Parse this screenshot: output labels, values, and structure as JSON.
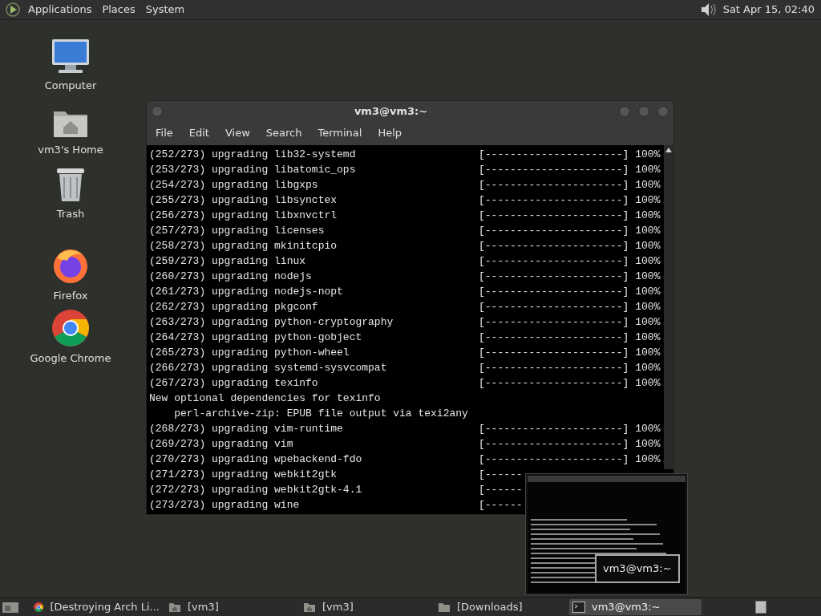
{
  "top_panel": {
    "menus": [
      "Applications",
      "Places",
      "System"
    ],
    "clock": "Sat Apr 15, 02:40"
  },
  "desktop_icons": [
    {
      "kind": "computer",
      "label": "Computer"
    },
    {
      "kind": "home",
      "label": "vm3's Home"
    },
    {
      "kind": "trash",
      "label": "Trash"
    },
    {
      "kind": "firefox",
      "label": "Firefox"
    },
    {
      "kind": "chrome",
      "label": "Google Chrome"
    }
  ],
  "terminal": {
    "title": "vm3@vm3:~",
    "menus": [
      "File",
      "Edit",
      "View",
      "Search",
      "Terminal",
      "Help"
    ],
    "lines": [
      {
        "kind": "progress",
        "text": "(252/273) upgrading lib32-systemd",
        "bar": "[----------------------]",
        "percent": "100%"
      },
      {
        "kind": "progress",
        "text": "(253/273) upgrading libatomic_ops",
        "bar": "[----------------------]",
        "percent": "100%"
      },
      {
        "kind": "progress",
        "text": "(254/273) upgrading libgxps",
        "bar": "[----------------------]",
        "percent": "100%"
      },
      {
        "kind": "progress",
        "text": "(255/273) upgrading libsynctex",
        "bar": "[----------------------]",
        "percent": "100%"
      },
      {
        "kind": "progress",
        "text": "(256/273) upgrading libxnvctrl",
        "bar": "[----------------------]",
        "percent": "100%"
      },
      {
        "kind": "progress",
        "text": "(257/273) upgrading licenses",
        "bar": "[----------------------]",
        "percent": "100%"
      },
      {
        "kind": "progress",
        "text": "(258/273) upgrading mkinitcpio",
        "bar": "[----------------------]",
        "percent": "100%"
      },
      {
        "kind": "progress",
        "text": "(259/273) upgrading linux",
        "bar": "[----------------------]",
        "percent": "100%"
      },
      {
        "kind": "progress",
        "text": "(260/273) upgrading nodejs",
        "bar": "[----------------------]",
        "percent": "100%"
      },
      {
        "kind": "progress",
        "text": "(261/273) upgrading nodejs-nopt",
        "bar": "[----------------------]",
        "percent": "100%"
      },
      {
        "kind": "progress",
        "text": "(262/273) upgrading pkgconf",
        "bar": "[----------------------]",
        "percent": "100%"
      },
      {
        "kind": "progress",
        "text": "(263/273) upgrading python-cryptography",
        "bar": "[----------------------]",
        "percent": "100%"
      },
      {
        "kind": "progress",
        "text": "(264/273) upgrading python-gobject",
        "bar": "[----------------------]",
        "percent": "100%"
      },
      {
        "kind": "progress",
        "text": "(265/273) upgrading python-wheel",
        "bar": "[----------------------]",
        "percent": "100%"
      },
      {
        "kind": "progress",
        "text": "(266/273) upgrading systemd-sysvcompat",
        "bar": "[----------------------]",
        "percent": "100%"
      },
      {
        "kind": "progress",
        "text": "(267/273) upgrading texinfo",
        "bar": "[----------------------]",
        "percent": "100%"
      },
      {
        "kind": "plain",
        "text": "New optional dependencies for texinfo"
      },
      {
        "kind": "plain",
        "text": "    perl-archive-zip: EPUB file output via texi2any"
      },
      {
        "kind": "progress",
        "text": "(268/273) upgrading vim-runtime",
        "bar": "[----------------------]",
        "percent": "100%"
      },
      {
        "kind": "progress",
        "text": "(269/273) upgrading vim",
        "bar": "[----------------------]",
        "percent": "100%"
      },
      {
        "kind": "progress",
        "text": "(270/273) upgrading wpebackend-fdo",
        "bar": "[----------------------]",
        "percent": "100%"
      },
      {
        "kind": "progress",
        "text": "(271/273) upgrading webkit2gtk",
        "bar": "[------"
      },
      {
        "kind": "progress",
        "text": "(272/273) upgrading webkit2gtk-4.1",
        "bar": "[------"
      },
      {
        "kind": "progress",
        "text": "(273/273) upgrading wine",
        "bar": "[------"
      }
    ]
  },
  "preview": {
    "title": "vm3@vm3:~"
  },
  "taskbar": {
    "items": [
      {
        "kind": "chrome",
        "label": "[Destroying Arch Li...",
        "selected": false
      },
      {
        "kind": "home",
        "label": "[vm3]",
        "selected": false
      },
      {
        "kind": "home",
        "label": "[vm3]",
        "selected": false
      },
      {
        "kind": "folder",
        "label": "[Downloads]",
        "selected": false
      },
      {
        "kind": "terminal",
        "label": "vm3@vm3:~",
        "selected": true
      }
    ]
  }
}
